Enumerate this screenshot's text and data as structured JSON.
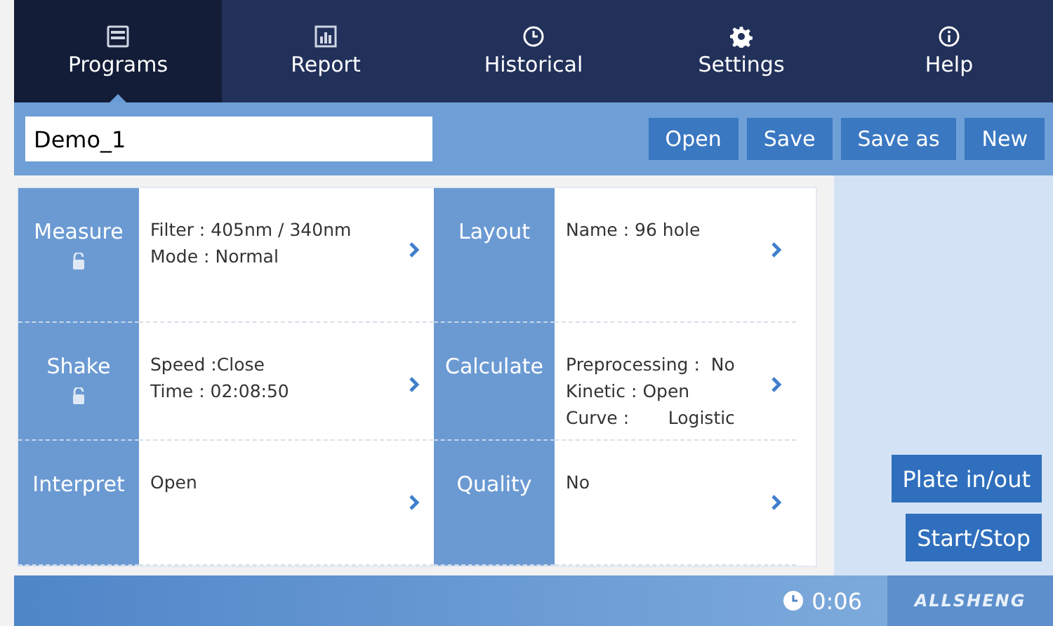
{
  "tabs": [
    {
      "label": "Programs",
      "selected": true
    },
    {
      "label": "Report",
      "selected": false
    },
    {
      "label": "Historical",
      "selected": false
    },
    {
      "label": "Settings",
      "selected": false
    },
    {
      "label": "Help",
      "selected": false
    }
  ],
  "program_name": {
    "value": "Demo_1"
  },
  "toolbar_buttons": [
    "Open",
    "Save",
    "Save as",
    "New"
  ],
  "sections": [
    {
      "label": "Measure",
      "lock": true,
      "lines": [
        "Filter : 405nm / 340nm",
        "Mode : Normal"
      ]
    },
    {
      "label": "Layout",
      "lock": false,
      "lines": [
        "Name : 96 hole"
      ]
    },
    {
      "label": "Shake",
      "lock": true,
      "lines": [
        "Speed :Close",
        "Time : 02:08:50"
      ]
    },
    {
      "label": "Calculate",
      "lock": false,
      "lines": [
        "Preprocessing :  No",
        "Kinetic : Open",
        "Curve :       Logistic"
      ]
    },
    {
      "label": "Interpret",
      "lock": false,
      "lines": [
        "Open"
      ]
    },
    {
      "label": "Quality",
      "lock": false,
      "lines": [
        "No"
      ]
    }
  ],
  "side_buttons": [
    "Plate in/out",
    "Start/Stop"
  ],
  "status_bar": {
    "time": "0:06",
    "brand": "ALLSHENG"
  }
}
